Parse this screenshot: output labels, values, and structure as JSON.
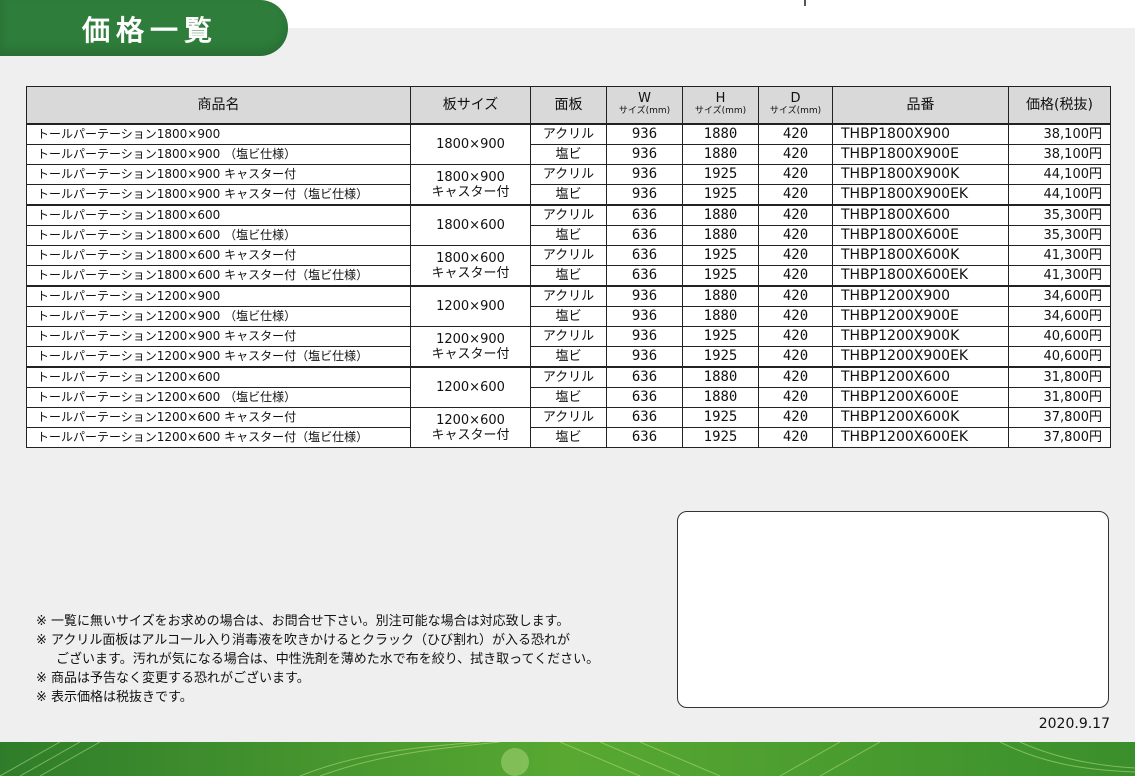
{
  "title": "価格一覧",
  "table": {
    "headers": {
      "name": "商品名",
      "size": "板サイズ",
      "panel": "面板",
      "w": "W",
      "h": "H",
      "d": "D",
      "dim_unit": "サイズ(mm)",
      "code": "品番",
      "price": "価格(税抜)"
    },
    "rows": [
      {
        "name": "トールパーテーション1800×900",
        "panel": "アクリル",
        "w": "936",
        "h": "1880",
        "d": "420",
        "code": "THBP1800X900",
        "price": "38,100円"
      },
      {
        "name": "トールパーテーション1800×900 （塩ビ仕様）",
        "panel": "塩ビ",
        "w": "936",
        "h": "1880",
        "d": "420",
        "code": "THBP1800X900E",
        "price": "38,100円"
      },
      {
        "name": "トールパーテーション1800×900 キャスター付",
        "panel": "アクリル",
        "w": "936",
        "h": "1925",
        "d": "420",
        "code": "THBP1800X900K",
        "price": "44,100円"
      },
      {
        "name": "トールパーテーション1800×900 キャスター付（塩ビ仕様）",
        "panel": "塩ビ",
        "w": "936",
        "h": "1925",
        "d": "420",
        "code": "THBP1800X900EK",
        "price": "44,100円"
      },
      {
        "name": "トールパーテーション1800×600",
        "panel": "アクリル",
        "w": "636",
        "h": "1880",
        "d": "420",
        "code": "THBP1800X600",
        "price": "35,300円"
      },
      {
        "name": "トールパーテーション1800×600 （塩ビ仕様）",
        "panel": "塩ビ",
        "w": "636",
        "h": "1880",
        "d": "420",
        "code": "THBP1800X600E",
        "price": "35,300円"
      },
      {
        "name": "トールパーテーション1800×600 キャスター付",
        "panel": "アクリル",
        "w": "636",
        "h": "1925",
        "d": "420",
        "code": "THBP1800X600K",
        "price": "41,300円"
      },
      {
        "name": "トールパーテーション1800×600 キャスター付（塩ビ仕様）",
        "panel": "塩ビ",
        "w": "636",
        "h": "1925",
        "d": "420",
        "code": "THBP1800X600EK",
        "price": "41,300円"
      },
      {
        "name": "トールパーテーション1200×900",
        "panel": "アクリル",
        "w": "936",
        "h": "1880",
        "d": "420",
        "code": "THBP1200X900",
        "price": "34,600円"
      },
      {
        "name": "トールパーテーション1200×900 （塩ビ仕様）",
        "panel": "塩ビ",
        "w": "936",
        "h": "1880",
        "d": "420",
        "code": "THBP1200X900E",
        "price": "34,600円"
      },
      {
        "name": "トールパーテーション1200×900 キャスター付",
        "panel": "アクリル",
        "w": "936",
        "h": "1925",
        "d": "420",
        "code": "THBP1200X900K",
        "price": "40,600円"
      },
      {
        "name": "トールパーテーション1200×900 キャスター付（塩ビ仕様）",
        "panel": "塩ビ",
        "w": "936",
        "h": "1925",
        "d": "420",
        "code": "THBP1200X900EK",
        "price": "40,600円"
      },
      {
        "name": "トールパーテーション1200×600",
        "panel": "アクリル",
        "w": "636",
        "h": "1880",
        "d": "420",
        "code": "THBP1200X600",
        "price": "31,800円"
      },
      {
        "name": "トールパーテーション1200×600 （塩ビ仕様）",
        "panel": "塩ビ",
        "w": "636",
        "h": "1880",
        "d": "420",
        "code": "THBP1200X600E",
        "price": "31,800円"
      },
      {
        "name": "トールパーテーション1200×600 キャスター付",
        "panel": "アクリル",
        "w": "636",
        "h": "1925",
        "d": "420",
        "code": "THBP1200X600K",
        "price": "37,800円"
      },
      {
        "name": "トールパーテーション1200×600 キャスター付（塩ビ仕様）",
        "panel": "塩ビ",
        "w": "636",
        "h": "1925",
        "d": "420",
        "code": "THBP1200X600EK",
        "price": "37,800円"
      }
    ],
    "size_groups": [
      {
        "line1": "1800×900",
        "line2": ""
      },
      {
        "line1": "1800×900",
        "line2": "キャスター付"
      },
      {
        "line1": "1800×600",
        "line2": ""
      },
      {
        "line1": "1800×600",
        "line2": "キャスター付"
      },
      {
        "line1": "1200×900",
        "line2": ""
      },
      {
        "line1": "1200×900",
        "line2": "キャスター付"
      },
      {
        "line1": "1200×600",
        "line2": ""
      },
      {
        "line1": "1200×600",
        "line2": "キャスター付"
      }
    ]
  },
  "notes": [
    "※ 一覧に無いサイズをお求めの場合は、お問合せ下さい。別注可能な場合は対応致します。",
    "※ アクリル面板はアルコール入り消毒液を吹きかけるとクラック（ひび割れ）が入る恐れが",
    "ございます。汚れが気になる場合は、中性洗剤を薄めた水で布を絞り、拭き取ってください。",
    "※ 商品は予告なく変更する恐れがございます。",
    "※ 表示価格は税抜きです。"
  ],
  "date": "2020.9.17",
  "colors": {
    "brand_green": "#2e7d3a",
    "footer_green": "#3e8e2c",
    "header_gray": "#d9d9d9"
  }
}
